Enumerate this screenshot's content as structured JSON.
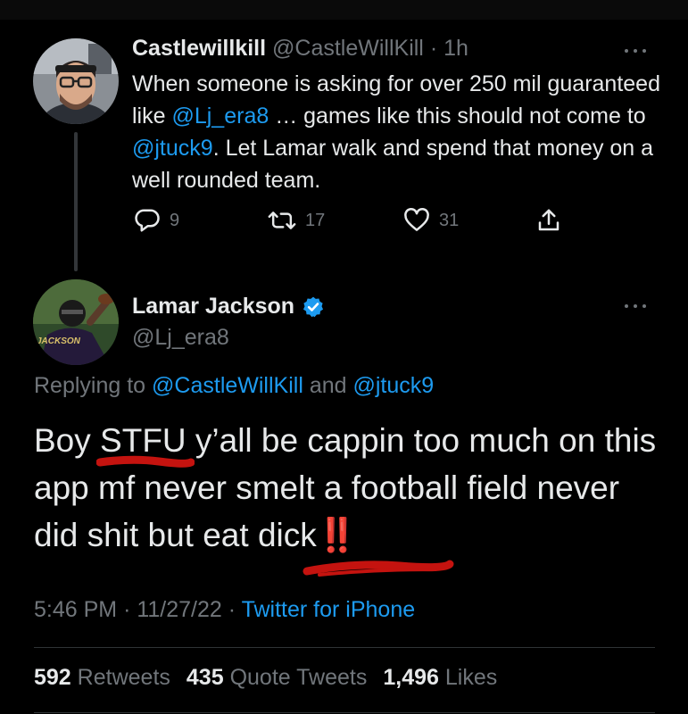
{
  "parent_tweet": {
    "display_name": "Castlewillkill",
    "handle": "@CastleWillKill",
    "separator": "·",
    "time": "1h",
    "text_parts": [
      "When someone is asking for over 250 mil guaranteed like ",
      "@Lj_era8",
      " … games like this should not come to ",
      "@jtuck9",
      ". Let Lamar walk and spend that money on a well rounded team."
    ],
    "replies": "9",
    "retweets": "17",
    "likes": "31"
  },
  "main_tweet": {
    "display_name": "Lamar Jackson",
    "handle": "@Lj_era8",
    "replying_prefix": "Replying to ",
    "replying_user1": "@CastleWillKill",
    "replying_and": " and ",
    "replying_user2": "@jtuck9",
    "text_part1": "Boy STFU y’all be cappin too much on this app mf never smelt a football field never did shit but eat dick",
    "text_emphasis": "‼️",
    "time": "5:46 PM",
    "separator1": "·",
    "date": "11/27/22",
    "separator2": "·",
    "source": "Twitter for iPhone",
    "stats": {
      "retweets_count": "592",
      "retweets_label": "Retweets",
      "quotes_count": "435",
      "quotes_label": "Quote Tweets",
      "likes_count": "1,496",
      "likes_label": "Likes"
    }
  },
  "colors": {
    "background": "#000000",
    "text": "#e7e9ea",
    "muted": "#71767b",
    "link": "#1d9bf0",
    "verified": "#1d9bf0",
    "annotation": "#c4130f"
  }
}
